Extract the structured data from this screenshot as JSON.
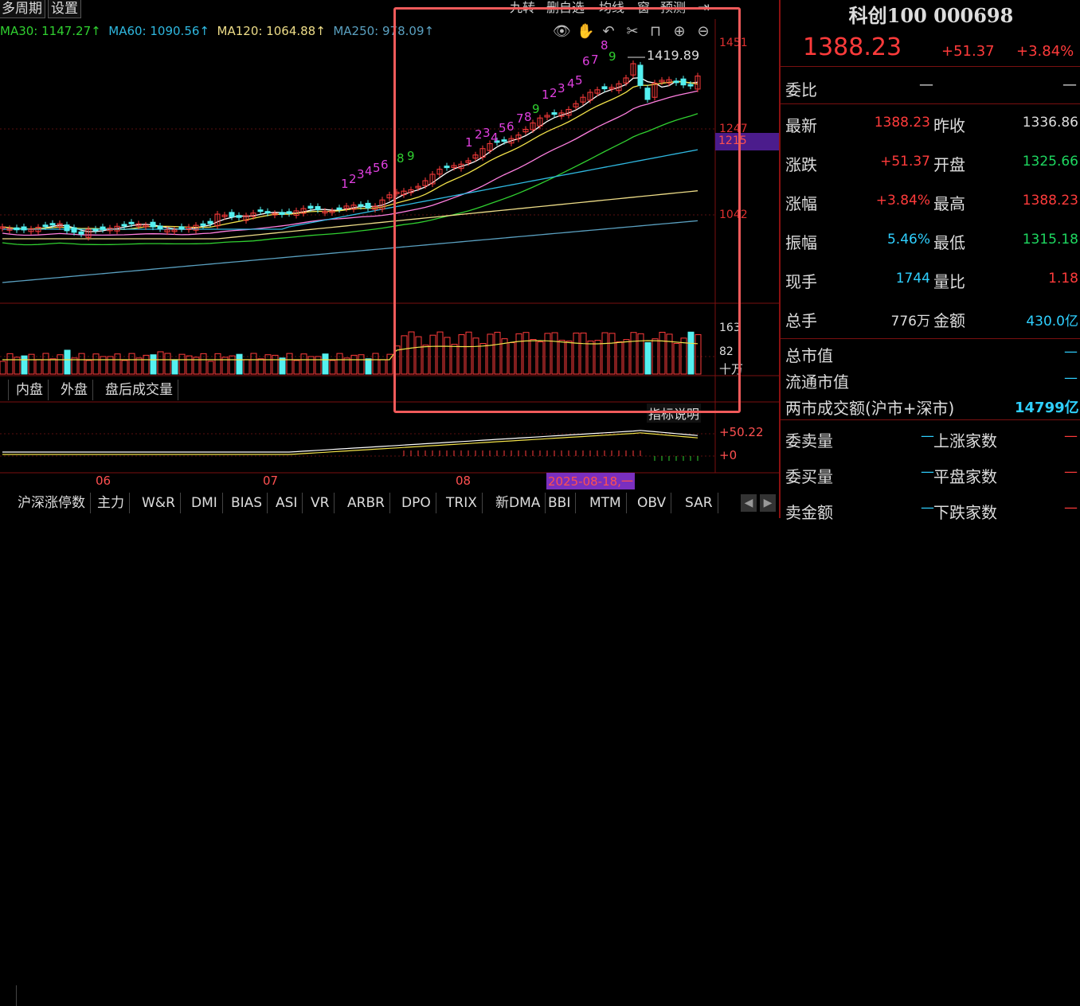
{
  "topbar": {
    "multi_period": "多周期",
    "settings": "设置",
    "nine_turn": "九转",
    "remove_watch": "删自选",
    "moving_avg": "均线",
    "window": "窗",
    "forecast": "预测",
    "pin": "⇥"
  },
  "ma": {
    "ma30": "MA30: 1147.27↑",
    "ma60": "MA60: 1090.56↑",
    "ma120": "MA120: 1064.88↑",
    "ma250": "MA250: 978.09↑"
  },
  "price_axis": [
    "1451",
    "1247",
    "1042"
  ],
  "price_tag": "1215",
  "high_label": "1419.89",
  "nine_marks": [
    {
      "t": "1"
    },
    {
      "t": "2"
    },
    {
      "t": "3"
    },
    {
      "t": "4"
    },
    {
      "t": "5"
    },
    {
      "t": "6"
    },
    {
      "t": "8"
    },
    {
      "t": "9"
    },
    {
      "t": "1"
    },
    {
      "t": "2"
    },
    {
      "t": "3"
    },
    {
      "t": "4"
    },
    {
      "t": "5"
    },
    {
      "t": "6"
    },
    {
      "t": "7"
    },
    {
      "t": "8"
    },
    {
      "t": "9"
    },
    {
      "t": "1"
    },
    {
      "t": "2"
    },
    {
      "t": "3"
    },
    {
      "t": "4"
    },
    {
      "t": "5"
    },
    {
      "t": "6"
    },
    {
      "t": "7"
    },
    {
      "t": "8"
    },
    {
      "t": "9"
    }
  ],
  "volume_axis": {
    "top": "163",
    "mid": "82",
    "unit": "十万"
  },
  "volume_tabs": [
    "内盘",
    "外盘",
    "盘后成交量"
  ],
  "indicator_help": "指标说明",
  "osc_axis": {
    "top": "50.22",
    "zero": "0"
  },
  "date_labels": [
    "06",
    "07",
    "08"
  ],
  "date_cursor": "2025-08-18,一",
  "indicator_tabs": [
    "沪深涨停数",
    "主力",
    "W&R",
    "DMI",
    "BIAS",
    "ASI",
    "VR",
    "ARBR",
    "DPO",
    "TRIX",
    "新DMA",
    "BBI",
    "MTM",
    "OBV",
    "SAR"
  ],
  "quote": {
    "title": "科创100 000698",
    "price": "1388.23",
    "change": "+51.37",
    "change_pct": "+3.84%",
    "commission_ratio_label": "委比",
    "commission_ratio_val": "—",
    "commission_ratio_val2": "—",
    "rows": [
      {
        "l1": "最新",
        "v1": "1388.23",
        "c1": "red",
        "l2": "昨收",
        "v2": "1336.86",
        "c2": "white"
      },
      {
        "l1": "涨跌",
        "v1": "+51.37",
        "c1": "red",
        "l2": "开盘",
        "v2": "1325.66",
        "c2": "green"
      },
      {
        "l1": "涨幅",
        "v1": "+3.84%",
        "c1": "red",
        "l2": "最高",
        "v2": "1388.23",
        "c2": "red"
      },
      {
        "l1": "振幅",
        "v1": "5.46%",
        "c1": "cyan",
        "l2": "最低",
        "v2": "1315.18",
        "c2": "green"
      },
      {
        "l1": "现手",
        "v1": "1744",
        "c1": "cyan",
        "l2": "量比",
        "v2": "1.18",
        "c2": "red"
      },
      {
        "l1": "总手",
        "v1": "776万",
        "c1": "white",
        "l2": "金额",
        "v2": "430.0亿",
        "c2": "cyan"
      }
    ],
    "total_cap_label": "总市值",
    "total_cap_val": "—",
    "float_cap_label": "流通市值",
    "float_cap_val": "—",
    "turnover_label": "两市成交额(沪市+深市)",
    "turnover_val": "14799亿",
    "bottom_rows": [
      {
        "l1": "委卖量",
        "v1": "—",
        "l2": "上涨家数",
        "v2": "—"
      },
      {
        "l1": "委买量",
        "v1": "—",
        "l2": "平盘家数",
        "v2": "—"
      },
      {
        "l1": "卖金额",
        "v1": "—",
        "l2": "下跌家数",
        "v2": "—"
      }
    ]
  },
  "colors": {
    "up": "#ff3b3b",
    "down": "#54f0f0",
    "accent": "#f05a5a",
    "ma5": "#ffffff",
    "ma10": "#f2e24a",
    "ma20": "#ff7fe0",
    "ma30": "#30d030",
    "ma60": "#2fb8e0",
    "ma120": "#eedd88",
    "ma250": "#5aa0c0"
  }
}
